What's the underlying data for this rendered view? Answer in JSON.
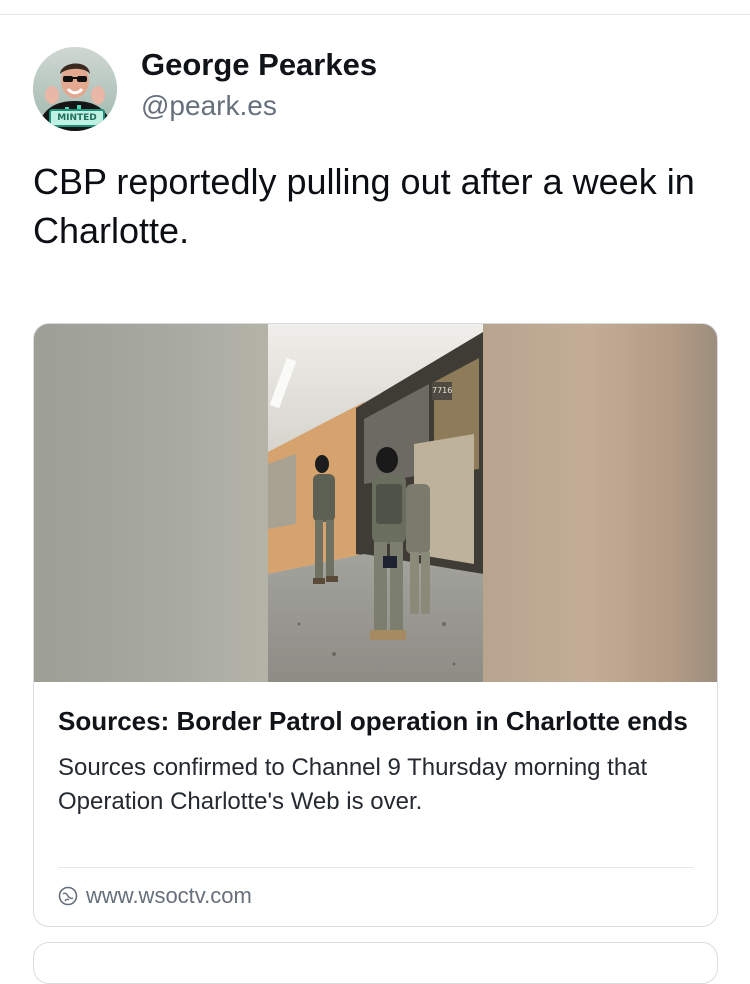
{
  "post": {
    "author": {
      "display_name": "George Pearkes",
      "handle": "@peark.es",
      "avatar_badge_text": "MINTED"
    },
    "text": "CBP reportedly pulling out after a week in Charlotte."
  },
  "link_card": {
    "title": "Sources: Border Patrol operation in Charlotte ends",
    "description": "Sources confirmed to Channel 9 Thursday morning that Operation Charlotte's Web is over.",
    "domain": "www.wsoctv.com",
    "domain_icon": "globe-icon",
    "image_sign_text": "7716"
  },
  "colors": {
    "border": "#d9dde2",
    "muted_text": "#66707c",
    "primary_text": "#0b0f14"
  }
}
